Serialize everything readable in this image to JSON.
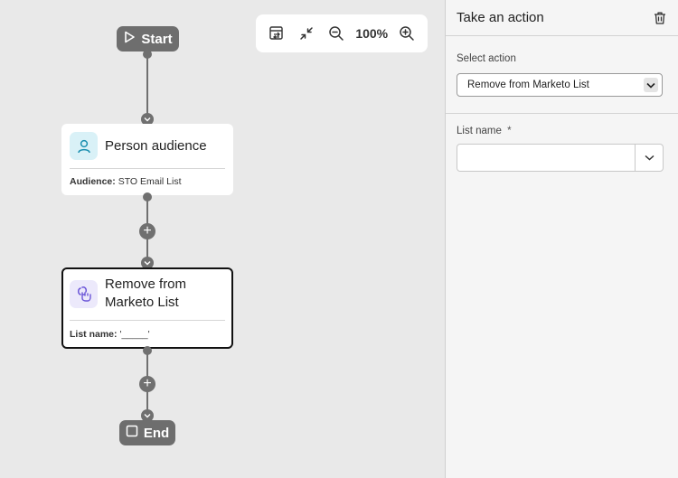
{
  "canvas": {
    "start_label": "Start",
    "end_label": "End",
    "toolbar": {
      "zoom_level": "100%",
      "icons": [
        "swap-layout-icon",
        "collapse-icon",
        "zoom-out-icon",
        "zoom-in-icon"
      ]
    },
    "nodes": {
      "audience": {
        "title": "Person audience",
        "detail_label": "Audience:",
        "detail_value": "STO Email List",
        "icon": "person-icon",
        "icon_bg": "#d9f1f7",
        "icon_color": "#1b8fb0"
      },
      "action": {
        "title_line1": "Remove from",
        "title_line2": "Marketo List",
        "detail_label": "List name:",
        "detail_value": "'_____'",
        "icon": "link-hand-icon",
        "icon_bg": "#ece9fb",
        "icon_color": "#6b55d8"
      }
    },
    "connector_color": "#707070",
    "pill_color": "#6e6e6e"
  },
  "panel": {
    "title": "Take an action",
    "select_action": {
      "label": "Select action",
      "value": "Remove from Marketo List"
    },
    "list_name": {
      "label": "List name",
      "required_mark": "*",
      "value": ""
    }
  }
}
